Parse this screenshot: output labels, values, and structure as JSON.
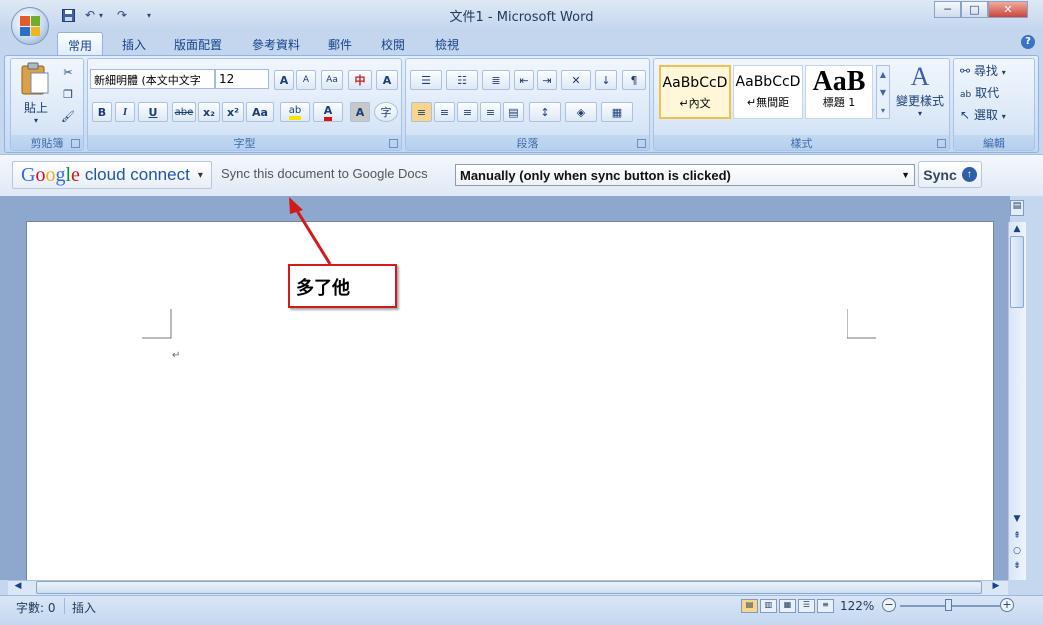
{
  "window": {
    "title": "文件1 - Microsoft Word",
    "minimize_glyph": "─",
    "maximize_glyph": "□",
    "close_glyph": "✕"
  },
  "quick_access": {
    "save_icon": "save-icon",
    "undo_icon": "undo-icon",
    "redo_icon": "redo-icon"
  },
  "tabs": [
    {
      "label": "常用",
      "active": true
    },
    {
      "label": "插入"
    },
    {
      "label": "版面配置"
    },
    {
      "label": "參考資料"
    },
    {
      "label": "郵件"
    },
    {
      "label": "校閱"
    },
    {
      "label": "檢視"
    }
  ],
  "help_glyph": "?",
  "clipboard": {
    "paste_label": "貼上",
    "group_label": "剪貼簿"
  },
  "font": {
    "font_name": "新細明體 (本文中文字",
    "font_size": "12",
    "bold": "B",
    "italic": "I",
    "underline": "U",
    "strikethrough": "abe",
    "subscript": "x₂",
    "superscript": "x²",
    "change_case": "Aa",
    "char_border": "A",
    "enclose": "字",
    "grow": "A",
    "shrink": "A",
    "pinyin": "中",
    "group_label": "字型"
  },
  "paragraph": {
    "group_label": "段落"
  },
  "styles": {
    "items": [
      {
        "sample": "AaBbCcD",
        "name": "↵內文"
      },
      {
        "sample": "AaBbCcD",
        "name": "↵無間距"
      },
      {
        "sample": "AaB",
        "name": "標題 1"
      }
    ],
    "change_styles_label": "變更樣式",
    "group_label": "樣式"
  },
  "editing": {
    "find_label": "尋找",
    "replace_label": "取代",
    "select_label": "選取",
    "group_label": "編輯"
  },
  "cloud_connect": {
    "google_letters": [
      "G",
      "o",
      "o",
      "g",
      "l",
      "e"
    ],
    "google_colors": [
      "#3369e8",
      "#d50f25",
      "#eeb211",
      "#3369e8",
      "#009925",
      "#d50f25"
    ],
    "product_label": "cloud connect",
    "dropdown_glyph": "▾",
    "sync_description": "Sync this document to Google Docs",
    "sync_mode": "Manually (only when sync button is clicked)",
    "sync_button_label": "Sync",
    "sync_button_icon": "up-arrow-icon"
  },
  "annotation": {
    "callout_text": "多了他",
    "color": "#d11a1a"
  },
  "status": {
    "word_count": "字數: 0",
    "insert_mode": "插入",
    "zoom": "122%"
  }
}
